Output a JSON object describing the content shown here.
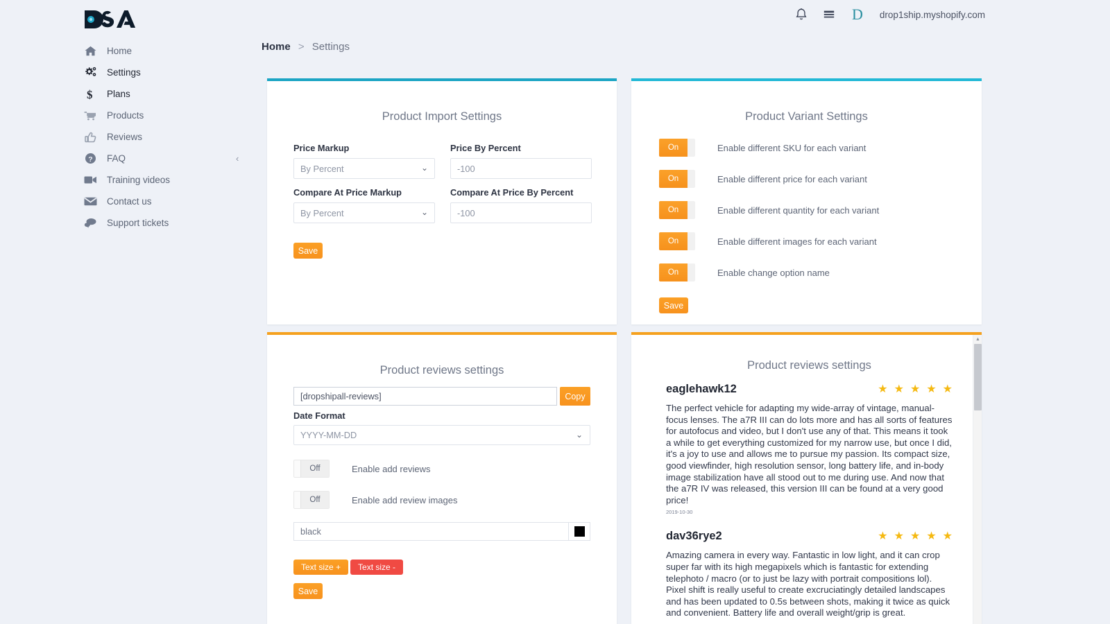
{
  "header": {
    "logo_text": "DSA",
    "bell_icon": "bell-icon",
    "card_icon": "billing-card-icon",
    "avatar_letter": "D",
    "shop_name": "drop1ship.myshopify.com"
  },
  "sidebar": {
    "collapse_label": "‹",
    "items": [
      {
        "label": "Home",
        "icon": "home-icon",
        "active": false
      },
      {
        "label": "Settings",
        "icon": "gears-icon",
        "active": true
      },
      {
        "label": "Plans",
        "icon": "dollar-icon",
        "active": true
      },
      {
        "label": "Products",
        "icon": "cart-icon",
        "active": false
      },
      {
        "label": "Reviews",
        "icon": "thumbs-up-icon",
        "active": false
      },
      {
        "label": "FAQ",
        "icon": "question-circle-icon",
        "active": false
      },
      {
        "label": "Training videos",
        "icon": "video-camera-icon",
        "active": false
      },
      {
        "label": "Contact us",
        "icon": "envelope-icon",
        "active": false
      },
      {
        "label": "Support tickets",
        "icon": "chat-bubbles-icon",
        "active": false
      }
    ]
  },
  "breadcrumb": {
    "home": "Home",
    "separator": ">",
    "current": "Settings"
  },
  "import_card": {
    "accent_color": "#1ba5c4",
    "title": "Product Import Settings",
    "fields": {
      "price_markup_label": "Price Markup",
      "price_markup_value": "By Percent",
      "price_by_percent_label": "Price By Percent",
      "price_by_percent_value": "-100",
      "compare_markup_label": "Compare At Price Markup",
      "compare_markup_value": "By Percent",
      "compare_percent_label": "Compare At Price By Percent",
      "compare_percent_value": "-100"
    },
    "save_label": "Save"
  },
  "variant_card": {
    "accent_color": "#21b8d6",
    "title": "Product Variant Settings",
    "toggles": [
      {
        "state": "On",
        "label": "Enable different SKU for each variant"
      },
      {
        "state": "On",
        "label": "Enable different price for each variant"
      },
      {
        "state": "On",
        "label": "Enable different quantity for each variant"
      },
      {
        "state": "On",
        "label": "Enable different images for each variant"
      },
      {
        "state": "On",
        "label": "Enable change option name"
      }
    ],
    "save_label": "Save"
  },
  "reviews_settings_card": {
    "accent_color": "#f5a11e",
    "title": "Product reviews settings",
    "shortcode_value": "[dropshipall-reviews]",
    "copy_label": "Copy",
    "date_format_label": "Date Format",
    "date_format_value": "YYYY-MM-DD",
    "toggles": [
      {
        "state": "Off",
        "label": "Enable add reviews"
      },
      {
        "state": "Off",
        "label": "Enable add review images"
      }
    ],
    "color_value": "black",
    "color_swatch": "#000000",
    "text_size_plus": "Text size +",
    "text_size_minus": "Text size -",
    "save_label": "Save"
  },
  "reviews_preview_card": {
    "accent_color": "#f5a11e",
    "title": "Product reviews settings",
    "star_color": "#f5b912",
    "reviews": [
      {
        "author": "eaglehawk12",
        "rating": 5,
        "text": "The perfect vehicle for adapting my wide-array of vintage, manual-focus lenses. The a7R III can do lots more and has all sorts of features for autofocus and video, but I don't use any of that. This means it took a while to get everything customized for my narrow use, but once I did, it's a joy to use and allows me to pursue my passion. Its compact size, good viewfinder, high resolution sensor, long battery life, and in-body image stabilization have all stood out to me during use. And now that the a7R IV was released, this version III can be found at a very good price!",
        "date": "2019-10-30"
      },
      {
        "author": "dav36rye2",
        "rating": 5,
        "text": "Amazing camera in every way. Fantastic in low light, and it can crop super far with its high megapixels which is fantastic for extending telephoto / macro (or to just be lazy with portrait compositions lol). Pixel shift is really useful to create excruciatingly detailed landscapes and has been updated to 0.5s between shots, making it twice as quick and convenient. Battery life and overall weight/grip is great.",
        "date": ""
      }
    ],
    "scroll_up": "▲",
    "scroll_down": "▼"
  }
}
